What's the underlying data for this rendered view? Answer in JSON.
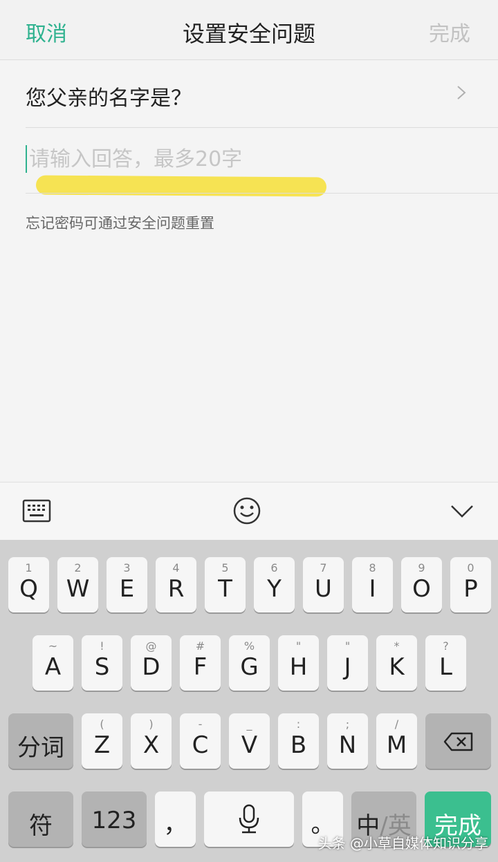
{
  "header": {
    "cancel": "取消",
    "title": "设置安全问题",
    "done": "完成"
  },
  "question": {
    "text": "您父亲的名字是？"
  },
  "answer": {
    "value": "",
    "placeholder": "请输入回答，最多20字"
  },
  "hint": "忘记密码可通过安全问题重置",
  "toolbar": {
    "left_icon": "keyboard-icon",
    "center_icon": "emoji-icon",
    "right_icon": "collapse-chevron-icon"
  },
  "keyboard": {
    "row1": [
      {
        "hint": "1",
        "key": "Q"
      },
      {
        "hint": "2",
        "key": "W"
      },
      {
        "hint": "3",
        "key": "E"
      },
      {
        "hint": "4",
        "key": "R"
      },
      {
        "hint": "5",
        "key": "T"
      },
      {
        "hint": "6",
        "key": "Y"
      },
      {
        "hint": "7",
        "key": "U"
      },
      {
        "hint": "8",
        "key": "I"
      },
      {
        "hint": "9",
        "key": "O"
      },
      {
        "hint": "0",
        "key": "P"
      }
    ],
    "row2": [
      {
        "hint": "~",
        "key": "A"
      },
      {
        "hint": "!",
        "key": "S"
      },
      {
        "hint": "@",
        "key": "D"
      },
      {
        "hint": "#",
        "key": "F"
      },
      {
        "hint": "%",
        "key": "G"
      },
      {
        "hint": "\"",
        "key": "H"
      },
      {
        "hint": "\"",
        "key": "J"
      },
      {
        "hint": "*",
        "key": "K"
      },
      {
        "hint": "?",
        "key": "L"
      }
    ],
    "row3": [
      {
        "hint": "(",
        "key": "Z"
      },
      {
        "hint": ")",
        "key": "X"
      },
      {
        "hint": "-",
        "key": "C"
      },
      {
        "hint": "_",
        "key": "V"
      },
      {
        "hint": ":",
        "key": "B"
      },
      {
        "hint": ";",
        "key": "N"
      },
      {
        "hint": "/",
        "key": "M"
      }
    ],
    "segment": "分词",
    "symbols": "符",
    "numbers": "123",
    "comma": "，",
    "period": "。",
    "lang_cn": "中",
    "lang_sep": "/",
    "lang_en": "英",
    "done": "完成"
  },
  "watermark": "头条 @小草自媒体知识分享",
  "colors": {
    "accent": "#2fb28f",
    "highlight": "#f6e24a"
  }
}
